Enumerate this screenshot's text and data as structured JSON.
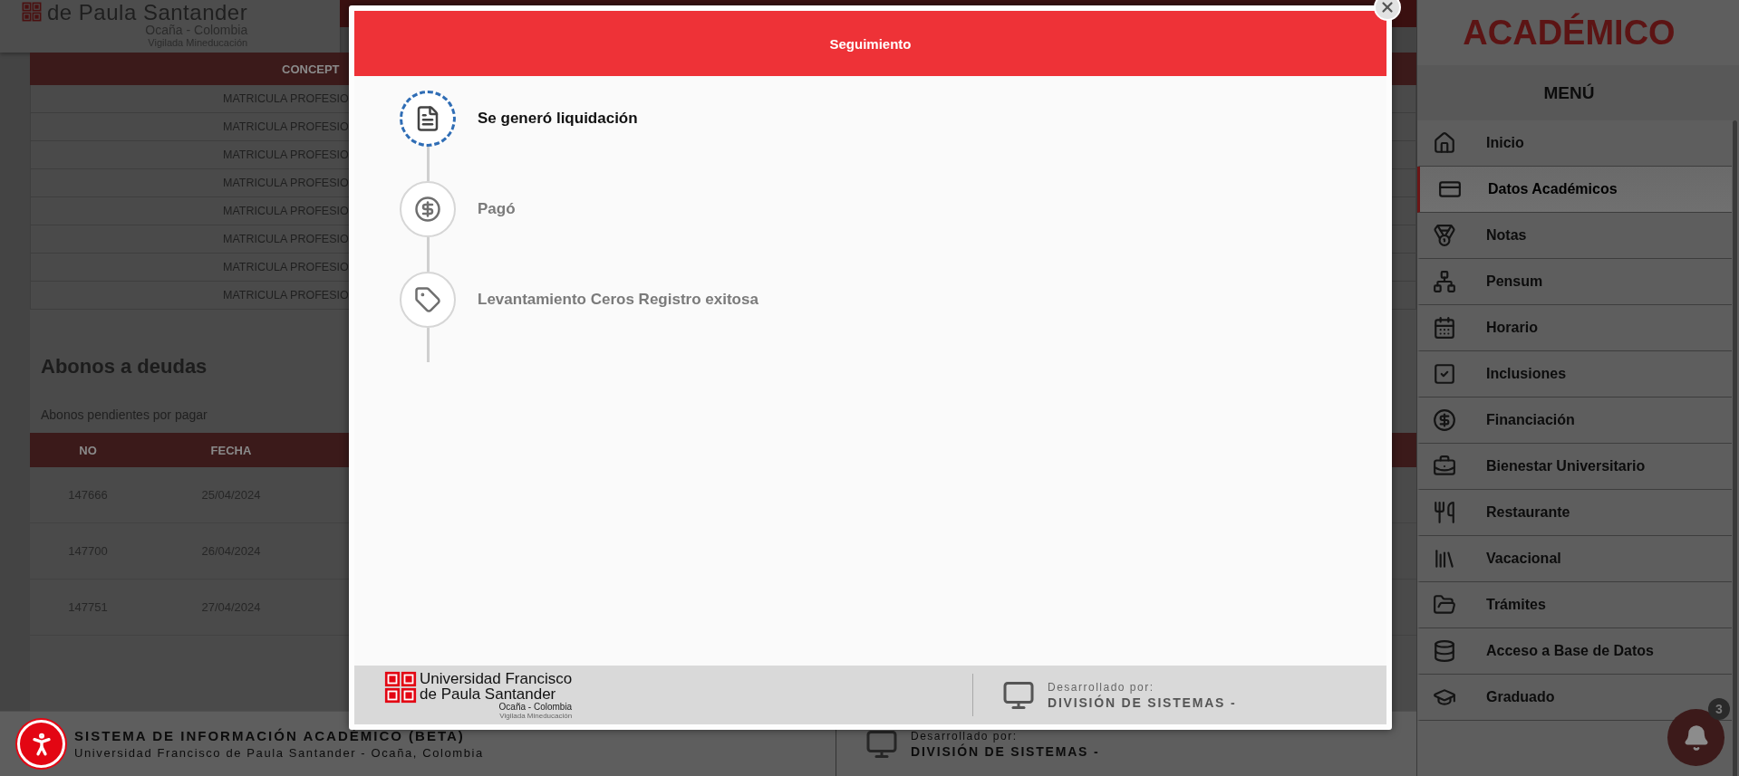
{
  "header": {
    "logo_line": "de Paula Santander",
    "location": "Ocaña - Colombia",
    "tagline": "Vigilada Mineducación"
  },
  "concept_table": {
    "columns": [
      "CONCEPT"
    ],
    "rows": [
      "MATRICULA PROFESIO",
      "MATRICULA PROFESIO",
      "MATRICULA PROFESIO",
      "MATRICULA PROFESIO",
      "MATRICULA PROFESIO",
      "MATRICULA PROFESIO",
      "MATRICULA PROFESIO",
      "MATRICULA PROFESIO"
    ]
  },
  "payments": {
    "title": "Abonos a deudas",
    "subtitle": "Abonos pendientes por pagar",
    "columns": [
      "NO",
      "FECHA"
    ],
    "rows": [
      [
        "147666",
        "25/04/2024"
      ],
      [
        "147700",
        "26/04/2024"
      ],
      [
        "147751",
        "27/04/2024"
      ]
    ]
  },
  "footer": {
    "title": "SISTEMA DE INFORMACIÓN ACADÉMICO (BETA)",
    "subtitle": "Universidad Francisco de Paula Santander - Ocaña, Colombia",
    "developed_label": "Desarrollado por:",
    "developer": "DIVISIÓN DE SISTEMAS -"
  },
  "sidebar": {
    "brand": "ACADÉMICO",
    "menu_title": "MENÚ",
    "items": [
      {
        "label": "Inicio",
        "selected": false
      },
      {
        "label": "Datos Académicos",
        "selected": true
      },
      {
        "label": "Notas",
        "selected": false
      },
      {
        "label": "Pensum",
        "selected": false
      },
      {
        "label": "Horario",
        "selected": false
      },
      {
        "label": "Inclusiones",
        "selected": false
      },
      {
        "label": "Financiación",
        "selected": false
      },
      {
        "label": "Bienestar Universitario",
        "selected": false
      },
      {
        "label": "Restaurante",
        "selected": false
      },
      {
        "label": "Vacacional",
        "selected": false
      },
      {
        "label": "Trámites",
        "selected": false
      },
      {
        "label": "Acceso a Base de Datos",
        "selected": false
      },
      {
        "label": "Graduado",
        "selected": false
      }
    ]
  },
  "notifications": {
    "count": "3"
  },
  "modal": {
    "title": "Seguimiento",
    "steps": [
      {
        "label": "Se generó liquidación",
        "active": true
      },
      {
        "label": "Pagó",
        "active": false
      },
      {
        "label": "Levantamiento Ceros Registro exitosa",
        "active": false
      }
    ],
    "footer": {
      "name_line_1": "Universidad Francisco",
      "name_line_2": "de Paula Santander",
      "location": "Ocaña - Colombia",
      "tagline": "Vigilada Mineducación",
      "developed_label": "Desarrollado por:",
      "developer": "DIVISIÓN DE SISTEMAS -"
    }
  }
}
